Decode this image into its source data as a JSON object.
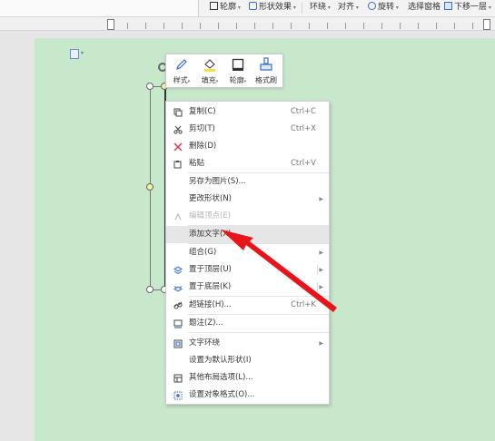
{
  "toolbar": {
    "outline_label": "轮廓",
    "shape_effect_label": "形状效果",
    "wrap_label": "环绕",
    "align_label": "对齐",
    "rotate_label": "旋转",
    "selection_pane_label": "选择窗格",
    "send_backward_label": "下移一层"
  },
  "mini_toolbar": {
    "items": [
      {
        "label": "样式",
        "icon": "pen-icon"
      },
      {
        "label": "填充",
        "icon": "fill-bucket-icon"
      },
      {
        "label": "轮廓",
        "icon": "outline-icon"
      },
      {
        "label": "格式刷",
        "icon": "format-painter-icon"
      }
    ]
  },
  "context_menu": {
    "items": [
      {
        "label": "复制(C)",
        "shortcut": "Ctrl+C",
        "icon": "copy-icon"
      },
      {
        "label": "剪切(T)",
        "shortcut": "Ctrl+X",
        "icon": "cut-icon"
      },
      {
        "label": "删除(D)",
        "icon": "delete-icon"
      },
      {
        "label": "粘贴",
        "shortcut": "Ctrl+V",
        "icon": "paste-icon"
      },
      {
        "label": "另存为图片(S)..."
      },
      {
        "label": "更改形状(N)"
      },
      {
        "label": "编辑顶点(E)",
        "icon": "edit-points-icon",
        "disabled": true
      },
      {
        "label": "添加文字(X)",
        "highlighted": true
      },
      {
        "label": "组合(G)"
      },
      {
        "label": "置于顶层(U)",
        "icon": "bring-front-icon"
      },
      {
        "label": "置于底层(K)",
        "icon": "send-back-icon"
      },
      {
        "label": "超链接(H)...",
        "shortcut": "Ctrl+K",
        "icon": "link-icon"
      },
      {
        "label": "题注(Z)...",
        "icon": "caption-icon"
      },
      {
        "label": "文字环绕",
        "icon": "wrap-icon"
      },
      {
        "label": "设置为默认形状(I)"
      },
      {
        "label": "其他布局选项(L)...",
        "icon": "layout-icon"
      },
      {
        "label": "设置对象格式(O)...",
        "icon": "format-object-icon"
      }
    ]
  },
  "colors": {
    "page_background": "#c8e8cc",
    "annotation_arrow": "#e8141a",
    "delete_icon": "#d9333f",
    "icon_blue": "#3b6fc2"
  }
}
